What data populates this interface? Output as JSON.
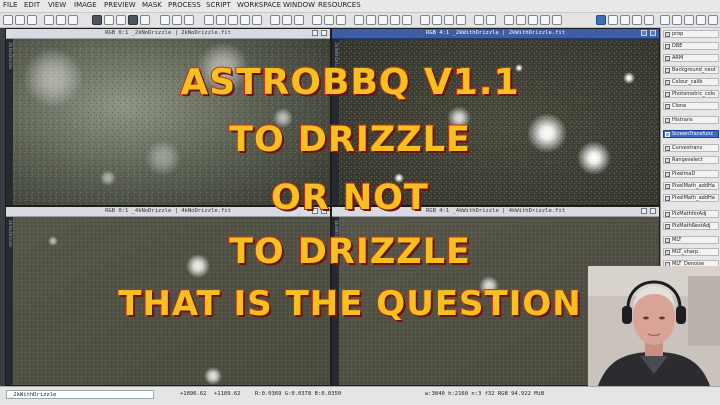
{
  "menu": [
    "FILE",
    "EDIT",
    "VIEW",
    "IMAGE",
    "PREVIEW",
    "MASK",
    "PROCESS",
    "SCRIPT",
    "WORKSPACE",
    "WINDOW",
    "RESOURCES"
  ],
  "windows": [
    {
      "title": "RGB 0:1 _2kNoDrizzle | 2kNoDrizzle.fit",
      "side": "2kNoDrizzle"
    },
    {
      "title": "RGB 4:1 _2kWithDrizzle | 2kWithDrizzle.fit",
      "side": "2kWithDrizzle"
    },
    {
      "title": "RGB 0:1 _4kNoDrizzle | 4kNoDrizzle.fit",
      "side": "4kNoDrizzle"
    },
    {
      "title": "RGB 4:1 _4kWithDrizzle | 4kWithDrizzle.fit",
      "side": "4kWithDrizzle"
    }
  ],
  "processes": [
    "prop",
    "DBE",
    "ARM",
    "Background_neut",
    "Colour_calib",
    "Photometric_colo",
    "Clone",
    "Histrans",
    "ScreenTransfunc",
    "Curvestrans",
    "Rangeselect",
    "PixelmaD",
    "PixelMath_addHa",
    "PixelMath_addHa",
    "PixMathforAdj",
    "PixMathRestAdj",
    "MLT",
    "MLT_sharp",
    "MLT_Denoise"
  ],
  "selected_process": "ScreenTransfunc",
  "overlay": {
    "line1": "ASTROBBQ V1.1",
    "line2": "TO DRIZZLE",
    "line3": "OR NOT",
    "line4": "TO DRIZZLE",
    "line5": "THAT IS THE QUESTION"
  },
  "status": {
    "view": "_2kWithDrizzle",
    "x": "+1896.62",
    "y": "+1109.62",
    "rgb": "R:0.0369  G:0.0378  B:0.0350",
    "info": "w:3840  h:2160  n:3  f32  RGB  94.922 MiB"
  },
  "colors": {
    "overlay_fill": "#f7c021",
    "overlay_stroke": "#c9300f",
    "active_title": "#3d5da6",
    "selected_item": "#3c6bd0"
  }
}
